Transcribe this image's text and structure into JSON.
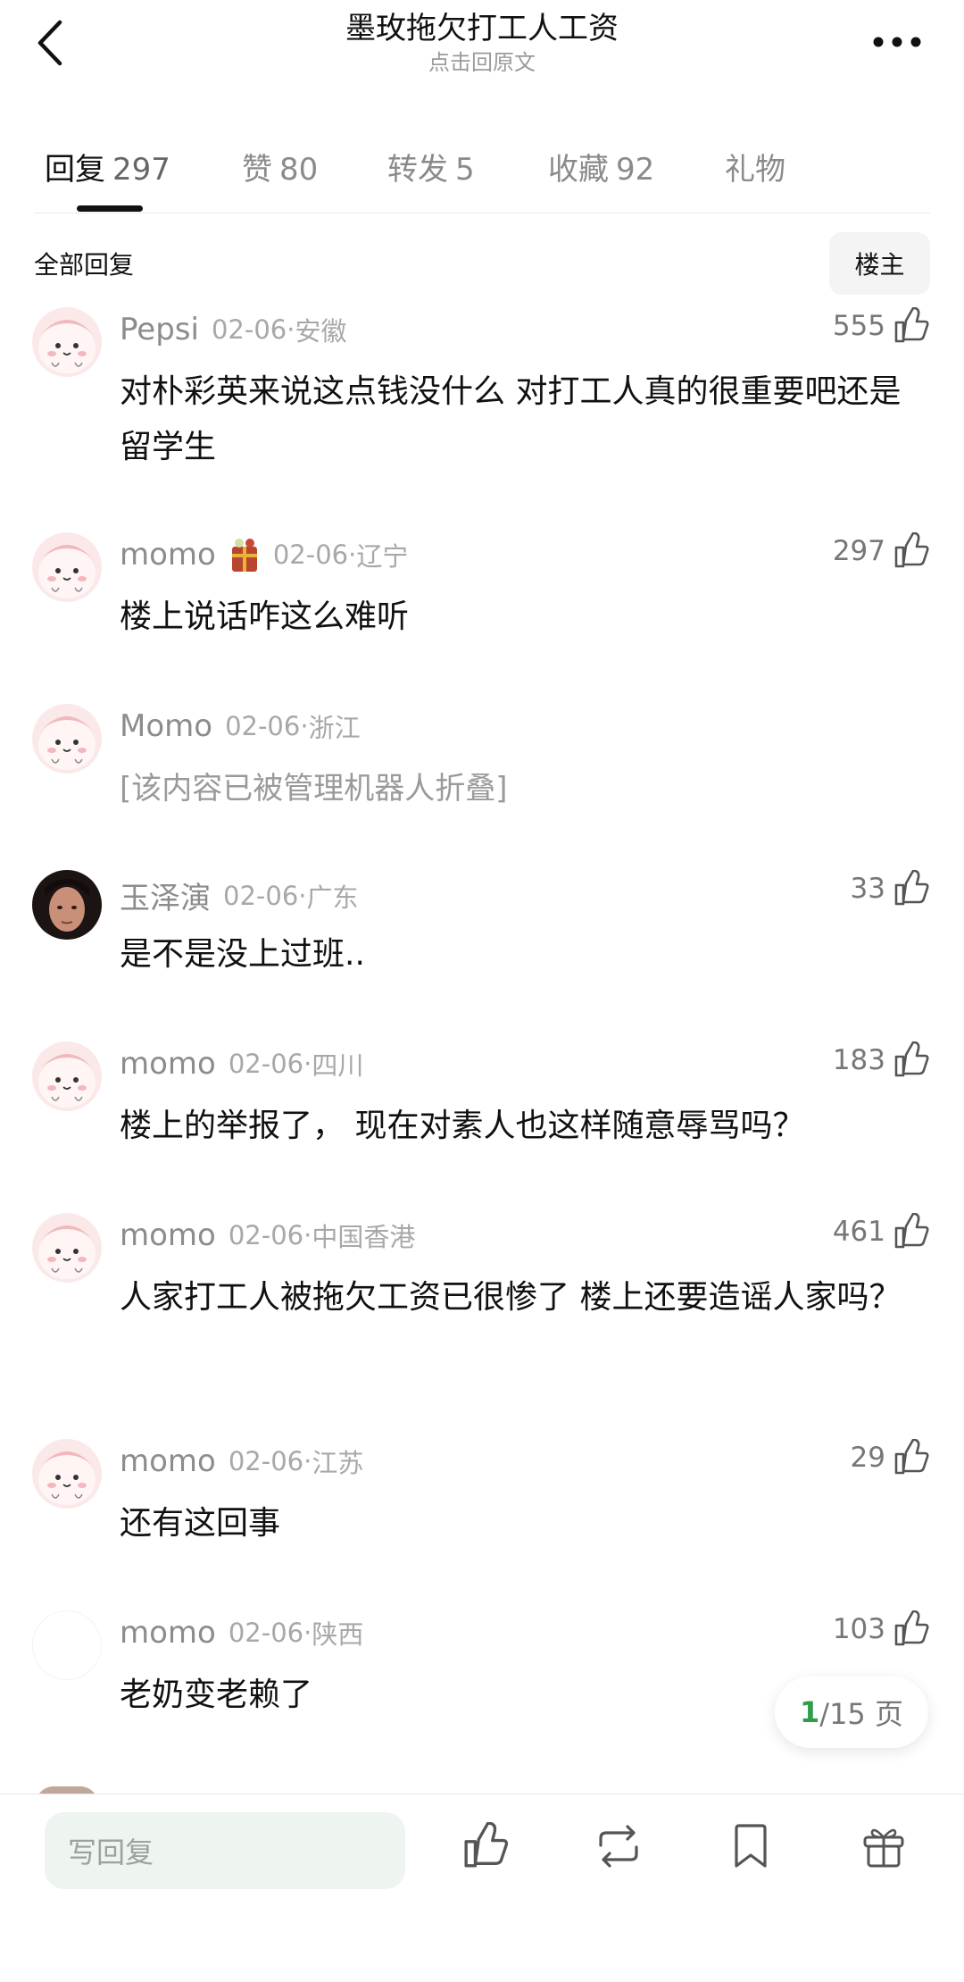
{
  "header": {
    "title": "墨玫拖欠打工人工资",
    "subtitle": "点击回原文"
  },
  "tabs": [
    {
      "label": "回复",
      "count": "297"
    },
    {
      "label": "赞",
      "count": "80"
    },
    {
      "label": "转发",
      "count": "5"
    },
    {
      "label": "收藏",
      "count": "92"
    },
    {
      "label": "礼物",
      "count": ""
    }
  ],
  "section": {
    "title": "全部回复",
    "owner_filter": "楼主"
  },
  "comments": [
    {
      "user": "Pepsi",
      "date": "02-06·",
      "loc": "安徽",
      "likes": "555",
      "text": "对朴彩英来说这点钱没什么 对打工人真的很重要吧还是留学生"
    },
    {
      "user": "momo",
      "date": "02-06·",
      "loc": "辽宁",
      "likes": "297",
      "text": "楼上说话咋这么难听"
    },
    {
      "user": "Momo",
      "date": "02-06·",
      "loc": "浙江",
      "likes": "",
      "text": "[该内容已被管理机器人折叠]"
    },
    {
      "user": "玉泽演",
      "date": "02-06·",
      "loc": "广东",
      "likes": "33",
      "text": "是不是没上过班.."
    },
    {
      "user": "momo",
      "date": "02-06·",
      "loc": "四川",
      "likes": "183",
      "text": "楼上的举报了， 现在对素人也这样随意辱骂吗？"
    },
    {
      "user": "momo",
      "date": "02-06·",
      "loc": "中国香港",
      "likes": "461",
      "text": "人家打工人被拖欠工资已很惨了 楼上还要造谣人家吗？"
    },
    {
      "user": "momo",
      "date": "02-06·",
      "loc": "江苏",
      "likes": "29",
      "text": "还有这回事"
    },
    {
      "user": "momo",
      "date": "02-06·",
      "loc": "陕西",
      "likes": "103",
      "text": "老奶变老赖了"
    }
  ],
  "pagination": {
    "current": "1",
    "total": "/15 页"
  },
  "bottom": {
    "reply_placeholder": "写回复"
  },
  "colors": {
    "accent_green": "#2e9e4b",
    "input_bg": "#eef4ef",
    "avatar_pink": "#f6d6d9"
  }
}
